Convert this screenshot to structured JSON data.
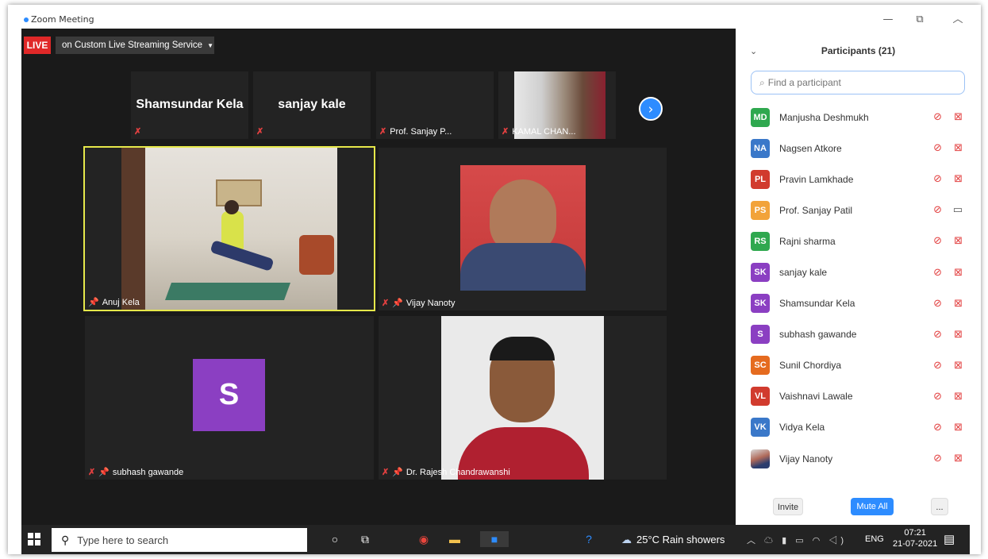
{
  "window": {
    "title": "Zoom Meeting"
  },
  "stream": {
    "live_label": "LIVE",
    "service_label": "on Custom Live Streaming Service"
  },
  "strip": [
    {
      "name": "Shamsundar Kela",
      "label": "",
      "show_big": true
    },
    {
      "name": "sanjay kale",
      "label": "",
      "show_big": true
    },
    {
      "name": "",
      "label": "Prof. Sanjay P...",
      "show_big": false
    },
    {
      "name": "",
      "label": "KAMAL CHAN...",
      "show_big": false
    }
  ],
  "gallery": [
    {
      "label": "Anuj Kela"
    },
    {
      "label": "Vijay Nanoty"
    },
    {
      "label": "subhash gawande",
      "avatar_letter": "S"
    },
    {
      "label": "Dr. Rajesh Chandrawanshi"
    }
  ],
  "panel": {
    "title": "Participants (21)",
    "search_placeholder": "Find a participant",
    "participants": [
      {
        "initials": "MD",
        "name": "Manjusha Deshmukh",
        "color": "#2fa84f",
        "video_on": false
      },
      {
        "initials": "NA",
        "name": "Nagsen Atkore",
        "color": "#3a78c9",
        "video_on": false
      },
      {
        "initials": "PL",
        "name": "Pravin Lamkhade",
        "color": "#d13b2e",
        "video_on": false
      },
      {
        "initials": "PS",
        "name": "Prof. Sanjay Patil",
        "color": "#f2a33a",
        "video_on": true
      },
      {
        "initials": "RS",
        "name": "Rajni sharma",
        "color": "#2fa84f",
        "video_on": false
      },
      {
        "initials": "SK",
        "name": "sanjay kale",
        "color": "#8b3fc2",
        "video_on": false
      },
      {
        "initials": "SK",
        "name": "Shamsundar Kela",
        "color": "#8b3fc2",
        "video_on": false
      },
      {
        "initials": "S",
        "name": "subhash gawande",
        "color": "#8b3fc2",
        "video_on": false
      },
      {
        "initials": "SC",
        "name": "Sunil Chordiya",
        "color": "#e56b1f",
        "video_on": false
      },
      {
        "initials": "VL",
        "name": "Vaishnavi Lawale",
        "color": "#d13b2e",
        "video_on": false
      },
      {
        "initials": "VK",
        "name": "Vidya Kela",
        "color": "#3a78c9",
        "video_on": false
      },
      {
        "initials": "",
        "name": "Vijay Nanoty",
        "color": "#cccccc",
        "video_on": false,
        "photo": true
      }
    ],
    "invite_label": "Invite",
    "mute_all_label": "Mute All",
    "more_label": "..."
  },
  "taskbar": {
    "search_placeholder": "Type here to search",
    "weather": "25°C  Rain showers",
    "lang": "ENG",
    "time": "07:21",
    "date": "21-07-2021"
  },
  "colors": {
    "accent": "#2d8cff",
    "live": "#e02828",
    "speaking_border": "#e6e84a"
  }
}
